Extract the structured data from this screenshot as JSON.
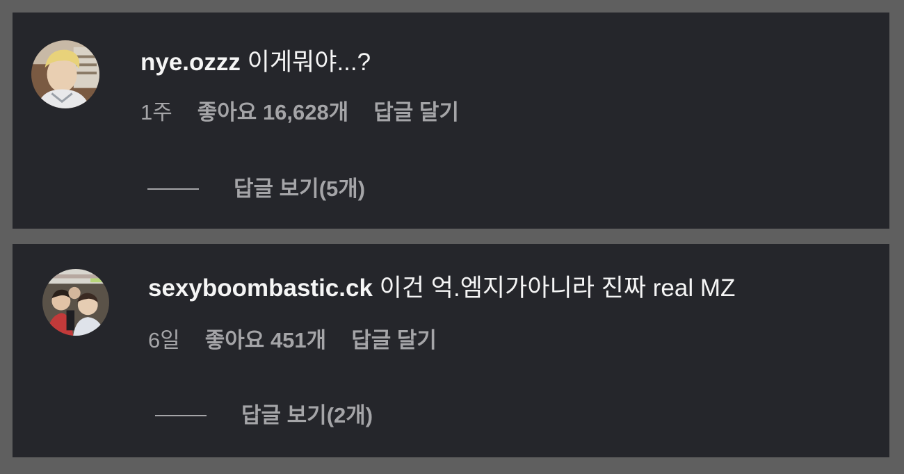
{
  "comments": [
    {
      "username": "nye.ozzz",
      "text": "이게뭐야...?",
      "time": "1주",
      "likes": "좋아요 16,628개",
      "reply_label": "답글 달기",
      "view_replies": "답글 보기(5개)"
    },
    {
      "username": "sexyboombastic.ck",
      "text": "이건 억.엠지가아니라 진짜 real MZ",
      "time": "6일",
      "likes": "좋아요 451개",
      "reply_label": "답글 달기",
      "view_replies": "답글 보기(2개)"
    }
  ],
  "colors": {
    "outer_background": "#5f5f5f",
    "card_background": "#25262b",
    "primary_text": "#f5f5f5",
    "secondary_text": "#a5a5a8"
  }
}
